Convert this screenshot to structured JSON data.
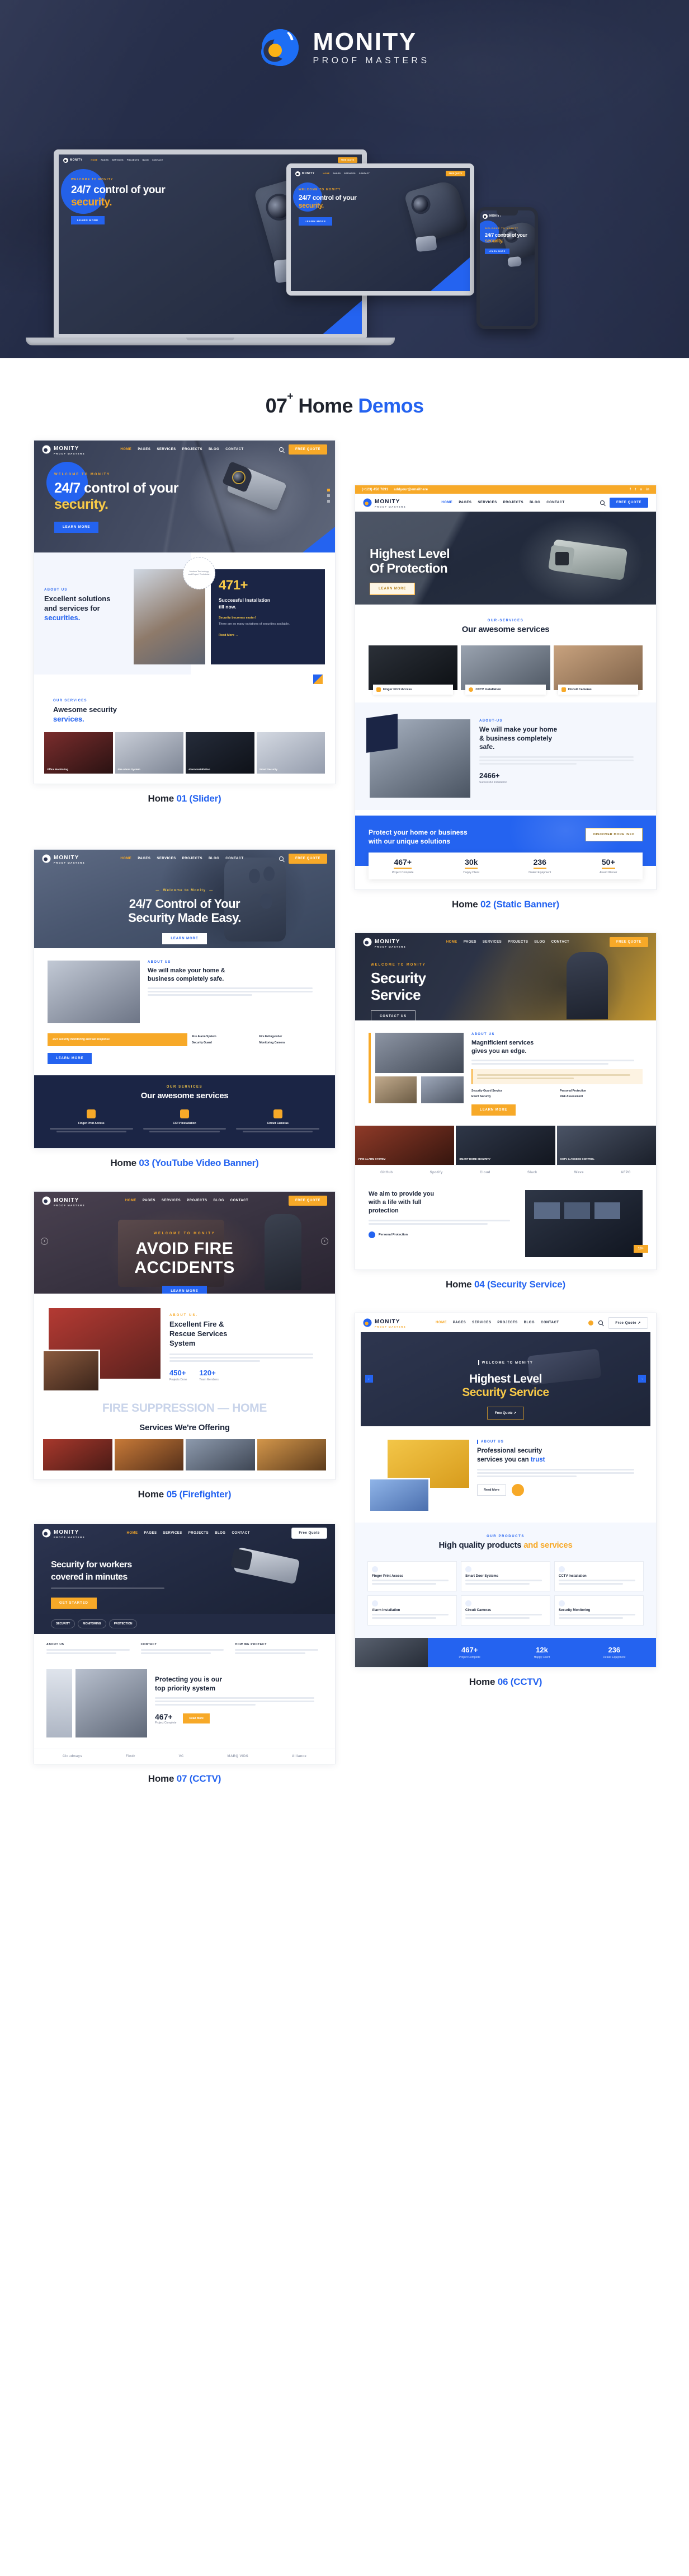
{
  "hero": {
    "brand_name": "MONITY",
    "brand_tagline": "PROOF MASTERS",
    "device_mock": {
      "eyebrow": "WELCOME TO MONITY",
      "headline_1": "24/7 control of your",
      "headline_2": "security.",
      "cta": "LEARN MORE",
      "menu": [
        "HOME",
        "PAGES",
        "SERVICES",
        "PROJECTS",
        "BLOG",
        "CONTACT"
      ],
      "nav_cta": "FREE QUOTE"
    }
  },
  "section": {
    "count": "07",
    "count_sup": "+",
    "title_plain": " Home ",
    "title_accent": "Demos"
  },
  "nav": {
    "menu": [
      "HOME",
      "PAGES",
      "SERVICES",
      "PROJECTS",
      "BLOG",
      "CONTACT"
    ],
    "quote": "FREE QUOTE",
    "quote_mixed": "Free Quote",
    "phone": "(+123) 456 7891",
    "email": "addyour@emailhere",
    "socials": [
      "f",
      "t",
      "o",
      "in"
    ]
  },
  "demos": [
    {
      "id": "home-01",
      "caption_plain": "Home ",
      "caption_accent": "01 (Slider)",
      "banner": {
        "eyebrow": "WELCOME TO MONITY",
        "h1": "24/7 control of your",
        "h2": "security.",
        "cta": "LEARN MORE"
      },
      "about": {
        "label": "ABOUT US",
        "title_1": "Excellent solutions",
        "title_2": "and services for",
        "title_accent": "securities.",
        "badge_text": "Modern Technology and Expert Technician",
        "stat_value": "471+",
        "stat_title_1": "Successful Installation",
        "stat_title_2": "till now.",
        "stat_lead": "Security becomes easier!",
        "stat_body": "There are so many variations of securities available.",
        "stat_link": "Read More →"
      },
      "services": {
        "label": "OUR SERVICES",
        "title_1": "Awesome security",
        "title_accent": "services.",
        "items": [
          "Office Monitoring",
          "Fire Alarm System",
          "Alarm Installation",
          "Smart Security"
        ]
      }
    },
    {
      "id": "home-02",
      "caption_plain": "Home ",
      "caption_accent": "02 (Static Banner)",
      "banner": {
        "h1": "Highest Level",
        "h2": "Of Protection",
        "cta": "LEARN MORE"
      },
      "services": {
        "label": "OUR-SERVICES",
        "title": "Our awesome services",
        "chips": [
          "Finger Print Access",
          "CCTV Installation",
          "Circuit Cameras"
        ]
      },
      "about": {
        "label": "ABOUT-US",
        "title_1": "We will make your home",
        "title_2": "& business completely",
        "title_3": "safe.",
        "stat_value": "2466+",
        "stat_label": "Successful Installation"
      },
      "cta_band": {
        "title_1": "Protect your home or business",
        "title_2": "with our unique solutions",
        "button": "DISCOVER MORE INFO"
      },
      "stats": [
        {
          "value": "467+",
          "label": "Project Complete"
        },
        {
          "value": "30k",
          "label": "Happy Client"
        },
        {
          "value": "236",
          "label": "Dealer Equipment"
        },
        {
          "value": "50+",
          "label": "Award Winner"
        }
      ]
    },
    {
      "id": "home-03",
      "caption_plain": "Home ",
      "caption_accent": "03 (YouTube Video Banner)",
      "banner": {
        "eyebrow": "Welcome to Monity",
        "h1": "24/7 Control of Your",
        "h2": "Security Made Easy.",
        "cta": "LEARN MORE"
      },
      "about": {
        "label": "ABOUT US",
        "title_1": "We will make your home &",
        "title_2": "business completely safe.",
        "note": "24/7 security monitoring and fast response",
        "features": [
          "Fire Alarm System",
          "Fire Extinguisher",
          "Security Guard",
          "Monitoring Camera"
        ],
        "cta": "LEARN MORE"
      },
      "services": {
        "label": "OUR SERVICES",
        "title": "Our awesome services",
        "items": [
          "Finger Print Access",
          "CCTV Installation",
          "Circuit Cameras"
        ]
      }
    },
    {
      "id": "home-04",
      "caption_plain": "Home ",
      "caption_accent": "04 (Security Service)",
      "banner": {
        "eyebrow": "WELCOME TO MONITY",
        "h1": "Security",
        "h2": "Service",
        "cta": "CONTACT US"
      },
      "about": {
        "label": "ABOUT US",
        "title_1": "Magnificient services",
        "title_2": "gives you an edge.",
        "points": [
          "Security Guard Service",
          "Personal Protection",
          "Event Security",
          "Risk Assessment"
        ],
        "cta": "LEARN MORE"
      },
      "tiles": [
        "FIRE ALARM SYSTEM",
        "SMART HOME SECURITY",
        "CCTV & ACCESS CONTROL"
      ],
      "brands": [
        "GitHub",
        "Spotify",
        "Cloud",
        "Slack",
        "Wave",
        "AFPC"
      ],
      "lower": {
        "title_1": "We aim to provide you",
        "title_2": "with a life with full",
        "title_3": "protection",
        "cta": "Personal Protection"
      }
    },
    {
      "id": "home-05",
      "caption_plain": "Home ",
      "caption_accent": "05 (Firefighter)",
      "banner": {
        "eyebrow": "WELCOME TO MONITY",
        "h1": "AVOID FIRE",
        "h2": "ACCIDENTS",
        "cta": "LEARN MORE"
      },
      "about": {
        "label": "ABOUT US.",
        "title_1": "Excellent Fire &",
        "title_2": "Rescue Services",
        "title_3": "System",
        "stats": [
          {
            "value": "450+",
            "label": "Projects Done"
          },
          {
            "value": "120+",
            "label": "Team Members"
          }
        ]
      },
      "marquee": "FIRE SUPPRESSION — HOME",
      "services_title": "Services We're Offering"
    },
    {
      "id": "home-06",
      "caption_plain": "Home ",
      "caption_accent": "06 (CCTV)",
      "banner": {
        "eyebrow": "WELCOME TO MONITY",
        "h1": "Highest Level",
        "h2": "Security Service",
        "cta": "Free Quote"
      },
      "about": {
        "label": "ABOUT US",
        "title_1": "Professional security",
        "title_2": "services you can",
        "title_accent": "trust",
        "cta": "Read More"
      },
      "products": {
        "label": "OUR PRODUCTS",
        "title_1": "High quality products",
        "title_accent": "and services",
        "items": [
          "Finger Print Access",
          "Smart Door Systems",
          "CCTV Installation",
          "Alarm Installation",
          "Circuit Cameras",
          "Security Monitoring"
        ]
      },
      "stats": [
        {
          "value": "467+",
          "label": "Project Complete"
        },
        {
          "value": "12k",
          "label": "Happy Client"
        },
        {
          "value": "236",
          "label": "Dealer Equipment"
        }
      ]
    },
    {
      "id": "home-07",
      "caption_plain": "Home ",
      "caption_accent": "07 (CCTV)",
      "banner": {
        "h1": "Security for workers",
        "h2": "covered in minutes",
        "cta": "GET STARTED"
      },
      "features": [
        "SECURITY",
        "MONITORING",
        "PROTECTION"
      ],
      "about": {
        "title_1": "Protecting you is our",
        "title_2": "top priority system",
        "stat_value": "467+",
        "stat_label": "Project Complete",
        "cta": "Read More"
      },
      "brands": [
        "Cloudways",
        "Findr",
        "VC",
        "MARQ VIDS",
        "Alliance"
      ]
    }
  ]
}
